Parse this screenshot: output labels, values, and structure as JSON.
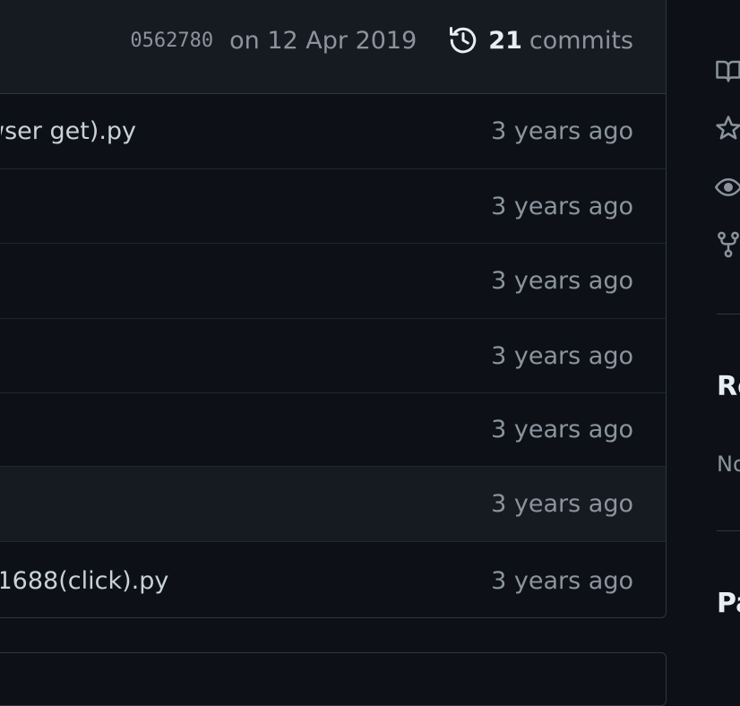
{
  "latest_commit": {
    "sha": "0562780",
    "date": "on 12 Apr 2019",
    "count": "21",
    "count_label": "commits"
  },
  "files": [
    {
      "name": "wser get).py",
      "age": "3 years ago"
    },
    {
      "name": "",
      "age": "3 years ago"
    },
    {
      "name": "",
      "age": "3 years ago"
    },
    {
      "name": "",
      "age": "3 years ago"
    },
    {
      "name": "",
      "age": "3 years ago"
    },
    {
      "name": "",
      "age": "3 years ago"
    },
    {
      "name": "_1688(click).py",
      "age": "3 years ago"
    }
  ],
  "sidebar": {
    "icons": [
      "book-icon",
      "star-icon",
      "eye-icon",
      "fork-icon"
    ],
    "releases_heading": "Re",
    "releases_text": "No",
    "packages_heading": "Pa"
  },
  "colors": {
    "background": "#0d1117",
    "header_background": "#161b22",
    "border": "#30363d",
    "muted_text": "#8b949e",
    "primary_text": "#e6edf3"
  }
}
